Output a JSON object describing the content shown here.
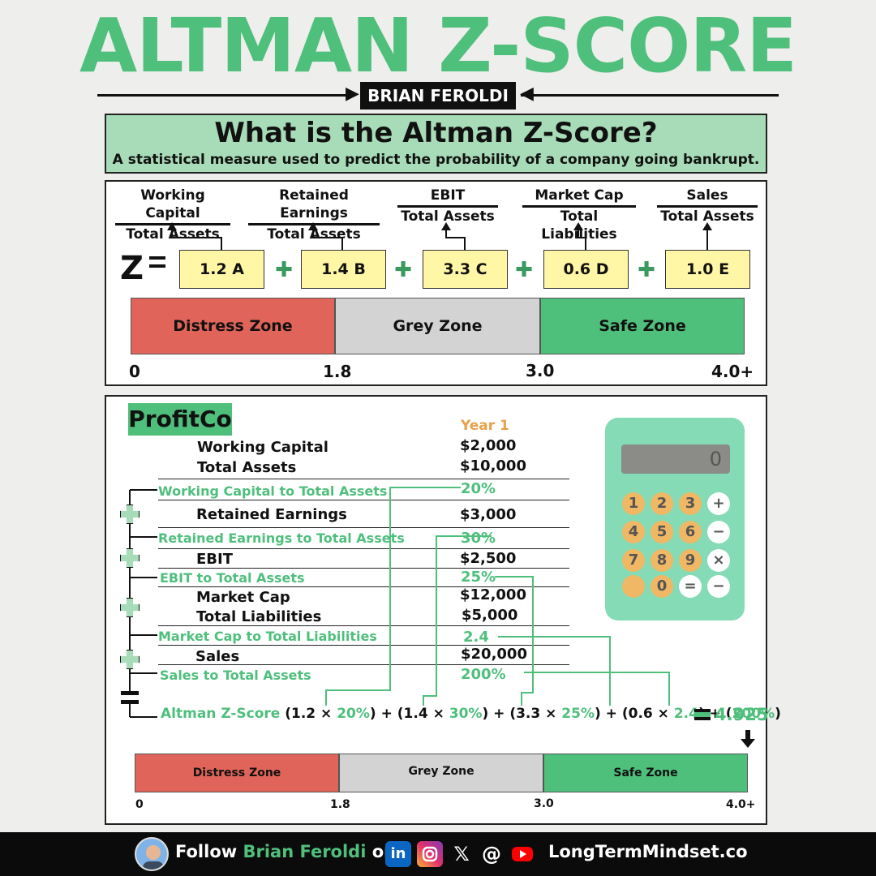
{
  "header": {
    "title": "ALTMAN Z-SCORE",
    "author": "BRIAN FEROLDI"
  },
  "intro": {
    "question": "What is the Altman Z-Score?",
    "description": "A statistical measure used to predict the probability of a company going bankrupt."
  },
  "formula": {
    "z": "Z",
    "ratios": [
      {
        "num": "Working Capital",
        "den": "Total Assets",
        "coef": "1.2 A"
      },
      {
        "num": "Retained Earnings",
        "den": "Total Assets",
        "coef": "1.4 B"
      },
      {
        "num": "EBIT",
        "den": "Total Assets",
        "coef": "3.3 C"
      },
      {
        "num": "Market Cap",
        "den": "Total Liabilities",
        "coef": "0.6 D"
      },
      {
        "num": "Sales",
        "den": "Total Assets",
        "coef": "1.0 E"
      }
    ]
  },
  "zones": {
    "labels": [
      "Distress Zone",
      "Grey Zone",
      "Safe Zone"
    ],
    "ticks": [
      "0",
      "1.8",
      "3.0",
      "4.0+"
    ],
    "colors": {
      "distress": "#e06459",
      "grey": "#d3d3d3",
      "safe": "#4fbf7c"
    }
  },
  "example": {
    "company": "ProfitCo",
    "year": "Year 1",
    "rows": [
      {
        "label": "Working Capital",
        "value": "$2,000"
      },
      {
        "label": "Total Assets",
        "value": "$10,000"
      },
      {
        "label": "Working Capital to Total Assets",
        "value": "20%"
      },
      {
        "label": "Retained Earnings",
        "value": "$3,000"
      },
      {
        "label": "Retained Earnings to Total Assets",
        "value": "30%"
      },
      {
        "label": "EBIT",
        "value": "$2,500"
      },
      {
        "label": "EBIT to Total Assets",
        "value": "25%"
      },
      {
        "label": "Market Cap",
        "value": "$12,000"
      },
      {
        "label": "Total Liabilities",
        "value": "$5,000"
      },
      {
        "label": "Market Cap to Total Liabilities",
        "value": "2.4"
      },
      {
        "label": "Sales",
        "value": "$20,000"
      },
      {
        "label": "Sales to Total Assets",
        "value": "200%"
      }
    ],
    "zscore_label": "Altman Z-Score",
    "calc": {
      "p1a": "(1.2 × ",
      "p1b": "20%",
      "p1c": ") + ",
      "p2a": "(1.4 × ",
      "p2b": "30%",
      "p2c": ") + ",
      "p3a": "(3.3 × ",
      "p3b": "25%",
      "p3c": ") + ",
      "p4a": "(0.6 × ",
      "p4b": "2.4",
      "p4c": ") + ",
      "p5a": "(",
      "p5b": "200%",
      "p5c": ")"
    },
    "result": "4.925"
  },
  "calculator": {
    "display": "0",
    "keys": [
      "1",
      "2",
      "3",
      "+",
      "4",
      "5",
      "6",
      "−",
      "7",
      "8",
      "9",
      "×",
      "",
      "0",
      "=",
      "−"
    ]
  },
  "footer": {
    "follow": "Follow",
    "name": "Brian Feroldi",
    "on": "on",
    "website": "LongTermMindset.co",
    "icons": [
      "linkedin-icon",
      "instagram-icon",
      "x-icon",
      "threads-icon",
      "youtube-icon"
    ]
  }
}
